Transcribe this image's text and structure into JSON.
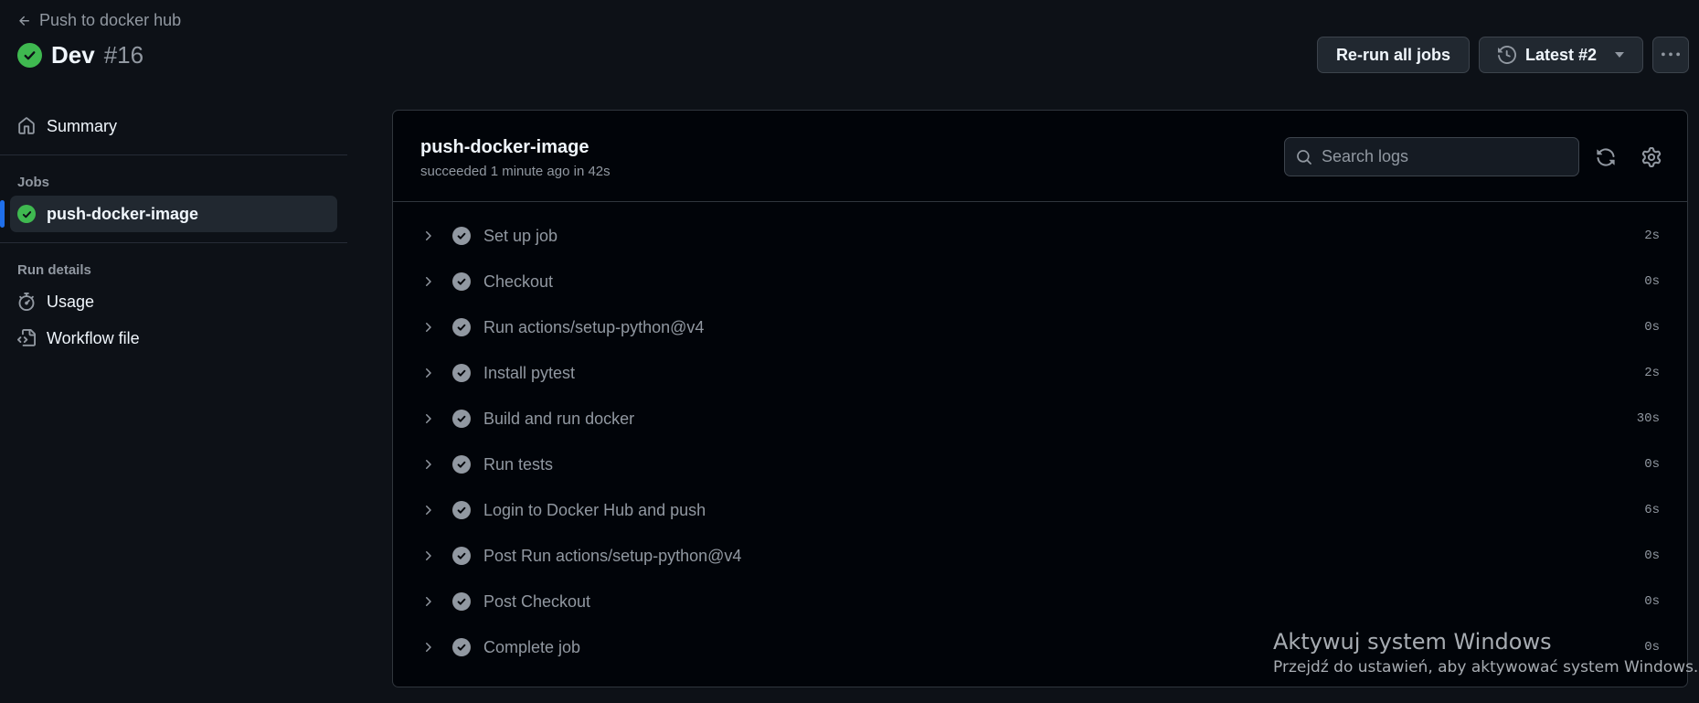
{
  "header": {
    "back_label": "Push to docker hub",
    "run_name": "Dev",
    "run_number": "#16",
    "rerun_label": "Re-run all jobs",
    "attempt_label": "Latest #2"
  },
  "sidebar": {
    "summary_label": "Summary",
    "jobs_heading": "Jobs",
    "jobs": [
      {
        "label": "push-docker-image",
        "status": "success"
      }
    ],
    "run_details_heading": "Run details",
    "details": [
      {
        "label": "Usage",
        "icon": "stopwatch-icon"
      },
      {
        "label": "Workflow file",
        "icon": "file-code-icon"
      }
    ]
  },
  "job": {
    "name": "push-docker-image",
    "status_text": "succeeded 1 minute ago in 42s",
    "search_placeholder": "Search logs",
    "steps": [
      {
        "name": "Set up job",
        "duration": "2s"
      },
      {
        "name": "Checkout",
        "duration": "0s"
      },
      {
        "name": "Run actions/setup-python@v4",
        "duration": "0s"
      },
      {
        "name": "Install pytest",
        "duration": "2s"
      },
      {
        "name": "Build and run docker",
        "duration": "30s"
      },
      {
        "name": "Run tests",
        "duration": "0s"
      },
      {
        "name": "Login to Docker Hub and push",
        "duration": "6s"
      },
      {
        "name": "Post Run actions/setup-python@v4",
        "duration": "0s"
      },
      {
        "name": "Post Checkout",
        "duration": "0s"
      },
      {
        "name": "Complete job",
        "duration": "0s"
      }
    ]
  },
  "watermark": {
    "title": "Aktywuj system Windows",
    "subtitle": "Przejdź do ustawień, aby aktywować system Windows."
  },
  "colors": {
    "background": "#0d1117",
    "success": "#3fb950",
    "accent": "#1f6feb",
    "muted": "#9198a1"
  }
}
